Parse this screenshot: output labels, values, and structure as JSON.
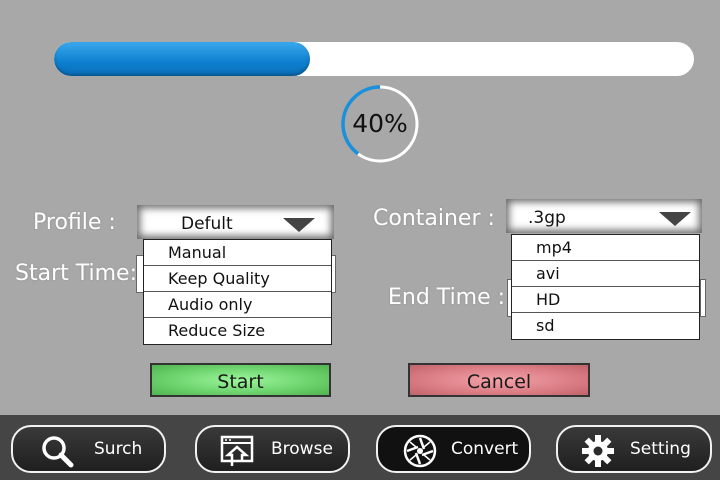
{
  "progress": {
    "fraction": 0.4,
    "percent_label": "40%"
  },
  "colors": {
    "progress": "#1a8fdc",
    "start": "#7ee07e",
    "cancel": "#e08c93",
    "background": "#a8a8a8"
  },
  "profile": {
    "label": "Profile :",
    "selected": "Defult",
    "options": [
      "Manual",
      "Keep Quality",
      "Audio only",
      "Reduce Size"
    ]
  },
  "container": {
    "label": "Container :",
    "selected": ".3gp",
    "options": [
      "mp4",
      "avi",
      "HD",
      "sd"
    ]
  },
  "start_time": {
    "label": "Start Time:"
  },
  "end_time": {
    "label": "End Time :"
  },
  "actions": {
    "start": "Start",
    "cancel": "Cancel"
  },
  "nav": {
    "items": [
      {
        "label": "Surch",
        "icon": "search-icon"
      },
      {
        "label": "Browse",
        "icon": "browse-icon"
      },
      {
        "label": "Convert",
        "icon": "convert-reel-icon",
        "active": true
      },
      {
        "label": "Setting",
        "icon": "gear-icon"
      }
    ]
  }
}
